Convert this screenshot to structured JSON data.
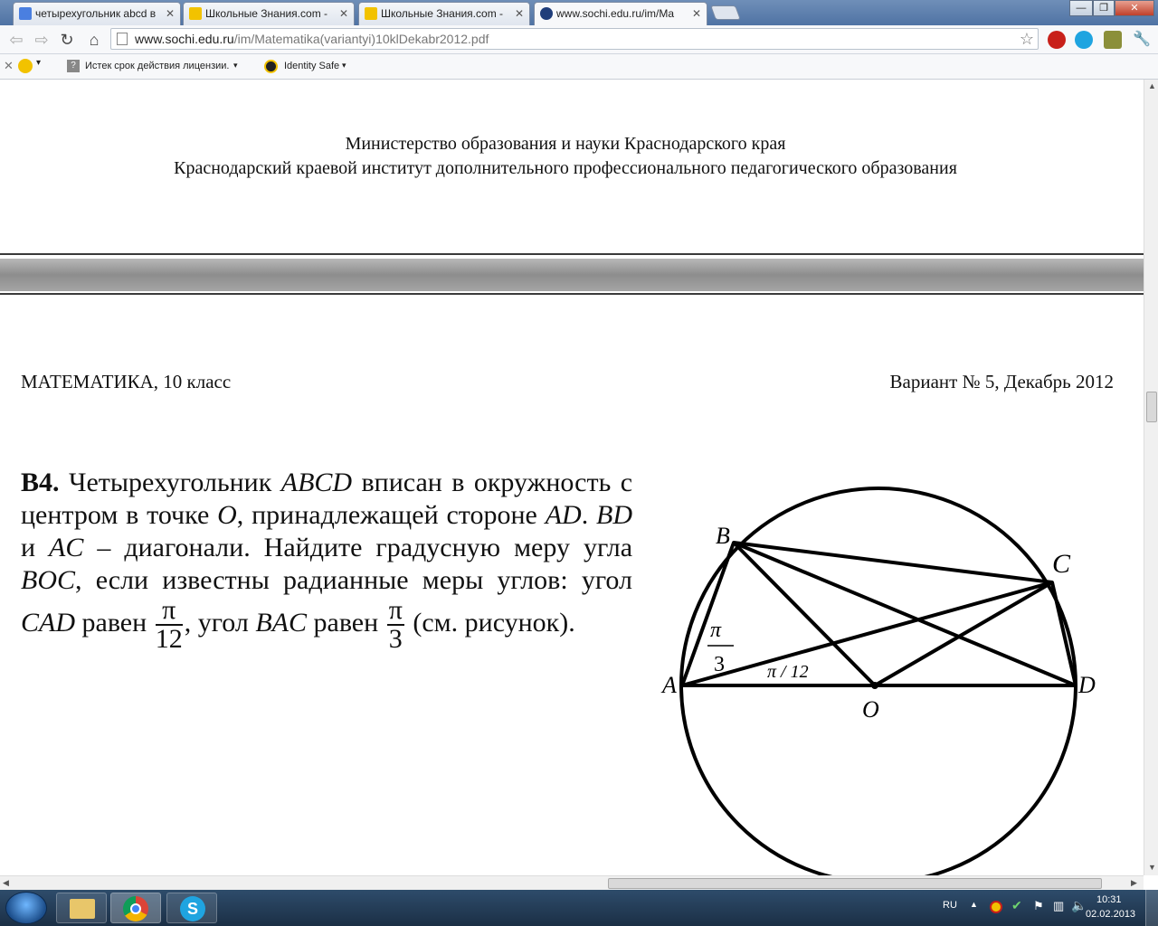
{
  "browser": {
    "tabs": [
      {
        "label": "четырехугольник abcd в",
        "favicon_color": "#4a7fe0",
        "active": false
      },
      {
        "label": "Школьные Знания.com -",
        "favicon_color": "#f2c200",
        "active": false
      },
      {
        "label": "Школьные Знания.com -",
        "favicon_color": "#f2c200",
        "active": false
      },
      {
        "label": "www.sochi.edu.ru/im/Ma",
        "favicon_color": "#1f3d7a",
        "active": true
      }
    ],
    "url_domain": "www.sochi.edu.ru",
    "url_path": "/im/Matematika(variantyi)10klDekabr2012.pdf",
    "bookmarks": [
      {
        "label": "Истек срок действия лицензии.",
        "icon": "question-icon"
      },
      {
        "label": "Identity Safe",
        "icon": "norton-icon"
      }
    ]
  },
  "document": {
    "header_line1": "Министерство образования и науки Краснодарского края",
    "header_line2": "Краснодарский краевой институт дополнительного профессионального педагогического образования",
    "subject": "МАТЕМАТИКА, 10 класс",
    "variant": "Вариант № 5, Декабрь 2012",
    "problem": {
      "number": "В4.",
      "text_1": "Четырехугольник",
      "abcd": "ABCD",
      "text_2": "вписан в окружность с центром в точке",
      "o": "O",
      "text_3": ", принадлежащей стороне",
      "ad": "AD",
      "text_4": ".",
      "bd": "BD",
      "text_5": "и",
      "ac": "AC",
      "text_6": "– диагонали. Найдите градусную меру угла",
      "boc": "BOC",
      "text_7": ", если известны радианные меры углов: угол",
      "cad": "CAD",
      "text_8": "равен",
      "frac1_num": "π",
      "frac1_den": "12",
      "text_9": ", угол",
      "bac": "BAC",
      "text_10": "равен",
      "frac2_num": "π",
      "frac2_den": "3",
      "text_11": "(см. рисунок)."
    },
    "figure": {
      "labels": {
        "A": "A",
        "B": "B",
        "C": "C",
        "D": "D",
        "O": "O"
      },
      "angle_bac_num": "π",
      "angle_bac_den": "3",
      "angle_cad": "π / 12"
    }
  },
  "taskbar": {
    "lang": "RU",
    "time": "10:31",
    "date": "02.02.2013"
  }
}
